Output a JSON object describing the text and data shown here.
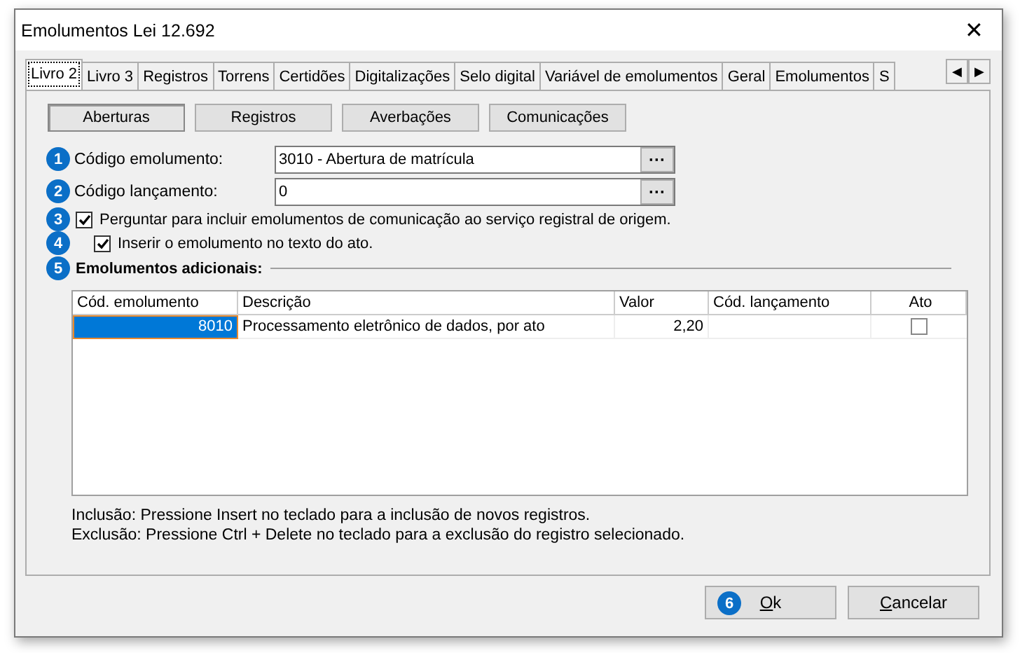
{
  "window": {
    "title": "Emolumentos Lei 12.692",
    "close": "✕"
  },
  "tabs": [
    {
      "label": "Livro 2",
      "selected": true
    },
    {
      "label": "Livro 3",
      "selected": false
    },
    {
      "label": "Registros",
      "selected": false
    },
    {
      "label": "Torrens",
      "selected": false
    },
    {
      "label": "Certidões",
      "selected": false
    },
    {
      "label": "Digitalizações",
      "selected": false
    },
    {
      "label": "Selo digital",
      "selected": false
    },
    {
      "label": "Variável de emolumentos",
      "selected": false
    },
    {
      "label": "Geral",
      "selected": false
    },
    {
      "label": "Emolumentos",
      "selected": false
    },
    {
      "label": "S",
      "selected": false
    }
  ],
  "tab_scroll": [
    "◀",
    "▶"
  ],
  "subtabs": [
    {
      "label": "Aberturas",
      "selected": true
    },
    {
      "label": "Registros",
      "selected": false
    },
    {
      "label": "Averbações",
      "selected": false
    },
    {
      "label": "Comunicações",
      "selected": false
    }
  ],
  "fields": [
    {
      "badge": "1",
      "label": "Código emolumento:",
      "value": "3010 - Abertura de matrícula",
      "button": "···"
    },
    {
      "badge": "2",
      "label": "Código lançamento:",
      "value": "0",
      "button": "···"
    }
  ],
  "checkboxes": [
    {
      "badge": "3",
      "label": "Perguntar para incluir emolumentos de comunicação ao serviço registral de origem.",
      "checked": true,
      "children": [
        {
          "badge": "4",
          "label": "Inserir o emolumento no texto do ato.",
          "checked": true
        }
      ]
    }
  ],
  "section": {
    "badge": "5",
    "title": "Emolumentos adicionais:"
  },
  "table": {
    "columns": [
      "Cód. emolumento",
      "Descrição",
      "Valor",
      "Cód. lançamento",
      "Ato"
    ],
    "rows": [
      {
        "codigo": "8010",
        "descricao": "Processamento eletrônico de dados, por ato",
        "valor": "2,20",
        "ato": false,
        "selected": true
      }
    ]
  },
  "hints": [
    "Inclusão: Pressione Insert no teclado para a inclusão de novos registros.",
    "Exclusão: Pressione Ctrl + Delete no teclado para a exclusão do registro selecionado."
  ],
  "buttons": [
    {
      "label": "Ok",
      "badge": "6"
    },
    {
      "label": "Cancelar"
    }
  ]
}
